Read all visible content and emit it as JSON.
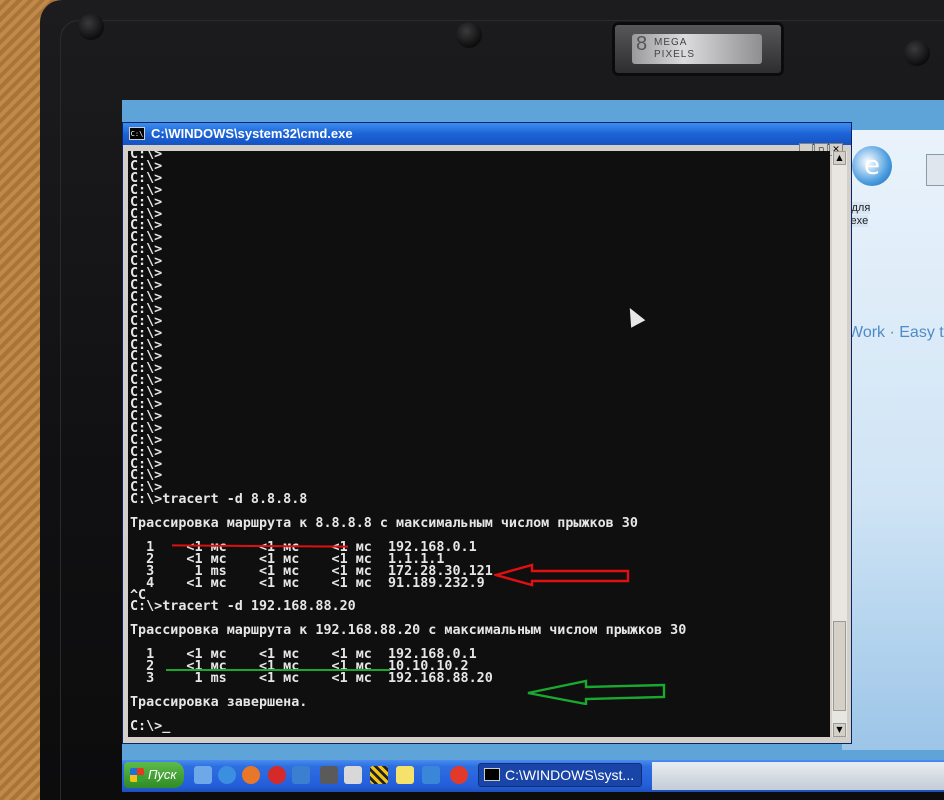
{
  "camera": {
    "brand_line1": "MEGA",
    "brand_line2": "PIXELS",
    "badge": "8"
  },
  "window": {
    "title": "C:\\WINDOWS\\system32\\cmd.exe",
    "icon": "cmd-icon"
  },
  "console": {
    "lines": [
      "C:\\>",
      "C:\\>",
      "C:\\>",
      "C:\\>",
      "C:\\>",
      "C:\\>",
      "C:\\>",
      "C:\\>",
      "C:\\>",
      "C:\\>",
      "C:\\>",
      "C:\\>",
      "C:\\>",
      "C:\\>",
      "C:\\>",
      "C:\\>",
      "C:\\>",
      "C:\\>",
      "C:\\>",
      "C:\\>",
      "C:\\>",
      "C:\\>",
      "C:\\>",
      "C:\\>",
      "C:\\>",
      "C:\\>",
      "C:\\>",
      "C:\\>",
      "C:\\>",
      "C:\\>tracert -d 8.8.8.8",
      "",
      "Трассировка маршрута к 8.8.8.8 с максимальным числом прыжков 30",
      "",
      "  1    <1 мс    <1 мс    <1 мс  192.168.0.1",
      "  2    <1 мс    <1 мс    <1 мс  1.1.1.1",
      "  3     1 ms    <1 мс    <1 мс  172.28.30.121",
      "  4    <1 мс    <1 мс    <1 мс  91.189.232.9",
      "^C",
      "C:\\>tracert -d 192.168.88.20",
      "",
      "Трассировка маршрута к 192.168.88.20 с максимальным числом прыжков 30",
      "",
      "  1    <1 мс    <1 мс    <1 мс  192.168.0.1",
      "  2    <1 мс    <1 мс    <1 мс  10.10.10.2",
      "  3     1 ms    <1 мс    <1 мс  192.168.88.20",
      "",
      "Трассировка завершена.",
      "",
      "C:\\>_"
    ]
  },
  "desktop": {
    "icon_label_line1": "< для",
    "icon_label_line2": "x.exe",
    "banner_text": "Work · Easy to"
  },
  "taskbar": {
    "start_label": "Пуск",
    "task_button_label": "C:\\WINDOWS\\syst..."
  },
  "annotations": {
    "underline1_color": "#e01010",
    "underline2_color": "#19a830",
    "arrow1_color": "#e01010",
    "arrow2_color": "#19a830"
  },
  "colors": {
    "console_bg": "#0f0f10",
    "console_fg": "#e6e6e6",
    "titlebar": "#1d63d6",
    "taskbar": "#245edb",
    "start": "#2f8b26"
  }
}
